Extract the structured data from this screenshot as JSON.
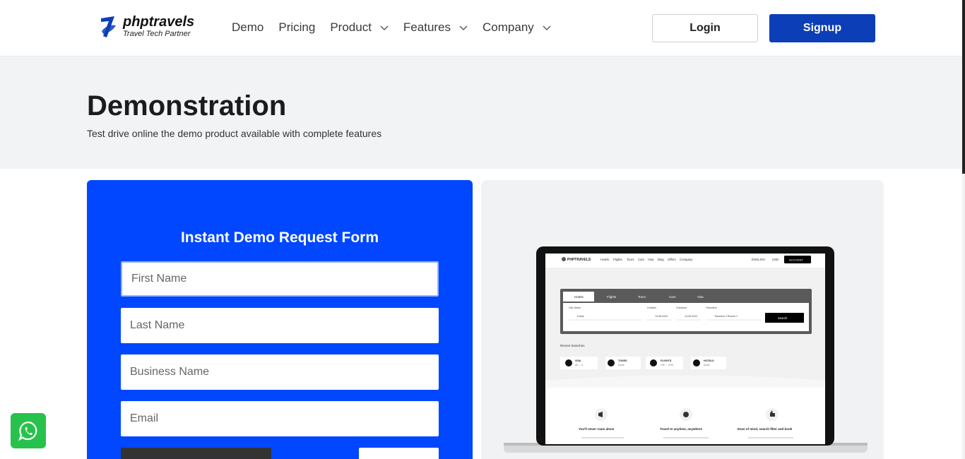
{
  "brand": {
    "name": "phptravels",
    "tagline": "Travel Tech Partner"
  },
  "nav": [
    {
      "label": "Demo",
      "dropdown": false
    },
    {
      "label": "Pricing",
      "dropdown": false
    },
    {
      "label": "Product",
      "dropdown": true
    },
    {
      "label": "Features",
      "dropdown": true
    },
    {
      "label": "Company",
      "dropdown": true
    }
  ],
  "auth": {
    "login_label": "Login",
    "signup_label": "Signup"
  },
  "hero": {
    "title": "Demonstration",
    "subtitle": "Test drive online the demo product available with complete features"
  },
  "form": {
    "title": "Instant Demo Request Form",
    "first_name_placeholder": "First Name",
    "last_name_placeholder": "Last Name",
    "business_name_placeholder": "Business Name",
    "email_placeholder": "Email"
  },
  "preview": {
    "brand": "PHPTRAVELS",
    "nav": [
      "Hotels",
      "Flights",
      "Tours",
      "Cars",
      "Visa",
      "Blog",
      "Offers",
      "Company"
    ],
    "language": "ENGLISH",
    "currency": "USD",
    "account": "ACCOUNT",
    "tabs": [
      "Hotels",
      "Flights",
      "Tours",
      "Cars",
      "Visa"
    ],
    "fields": {
      "city_label": "City Name",
      "city_value": "Dubai",
      "checkin_label": "Checkin",
      "checkin_value": "13-08-2022",
      "checkout_label": "Checkout",
      "checkout_value": "14-08-2022",
      "travellers_label": "Travellers",
      "travellers_value": "Travelers 2 Rooms 1",
      "search_label": "Search"
    },
    "recent_title": "Recent Searches",
    "recent": [
      {
        "title": "VISA",
        "sub": "AE → IL"
      },
      {
        "title": "TOURS",
        "sub": "Dubai"
      },
      {
        "title": "FLIGHTS",
        "sub": "LHE → DXB"
      },
      {
        "title": "HOTELS",
        "sub": "Dubai"
      }
    ],
    "features": [
      "You'll never roam alone",
      "Travel to anytime, anywhere",
      "Ease of mind, search filter and book"
    ]
  },
  "colors": {
    "primary": "#0b3eb7",
    "form_bg": "#0047ff",
    "whatsapp": "#27c24c"
  }
}
